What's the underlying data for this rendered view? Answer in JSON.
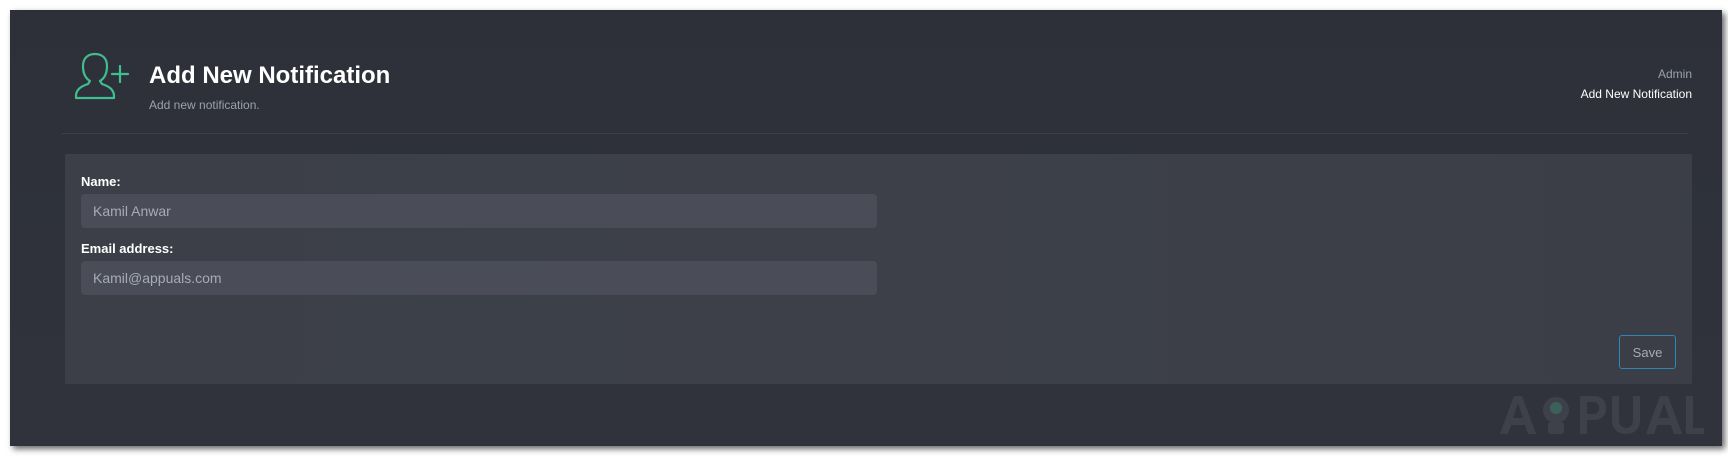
{
  "header": {
    "title": "Add New Notification",
    "subtitle": "Add new notification.",
    "icon": "add-user-icon"
  },
  "breadcrumb": {
    "parent": "Admin",
    "current": "Add New Notification"
  },
  "form": {
    "name": {
      "label": "Name:",
      "placeholder": "Kamil Anwar"
    },
    "email": {
      "label": "Email address:",
      "placeholder": "Kamil@appuals.com"
    },
    "save_label": "Save"
  },
  "colors": {
    "accent": "#3fbf8f",
    "button_border": "#2d87b9",
    "background": "#2f323b",
    "card": "#3c3f48"
  }
}
